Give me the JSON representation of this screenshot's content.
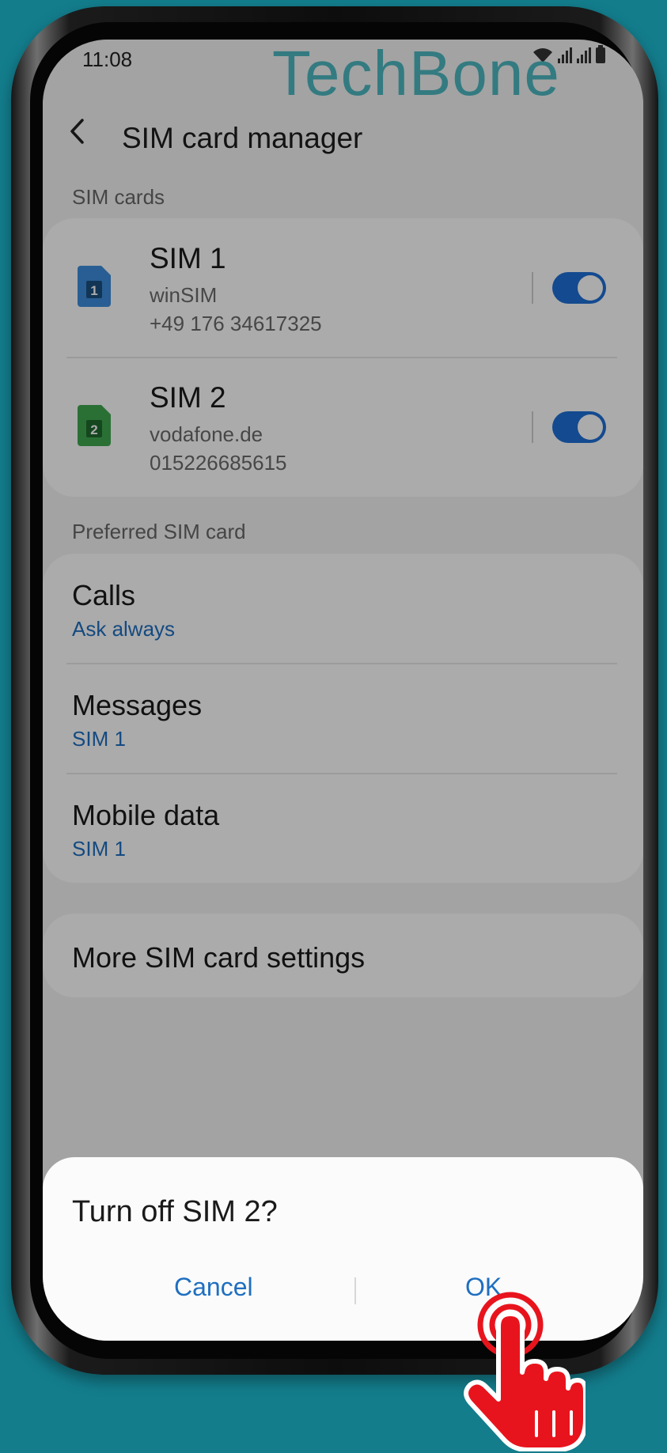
{
  "status": {
    "time": "11:08"
  },
  "watermark": "TechBone",
  "header": {
    "title": "SIM card manager"
  },
  "sim_section": {
    "header": "SIM cards",
    "sims": [
      {
        "badge": "1",
        "name": "SIM 1",
        "operator": "winSIM",
        "number": "+49 176 34617325",
        "enabled": true,
        "color": "#3d8ddb"
      },
      {
        "badge": "2",
        "name": "SIM 2",
        "operator": "vodafone.de",
        "number": "015226685615",
        "enabled": true,
        "color": "#3fa850"
      }
    ]
  },
  "preferred": {
    "header": "Preferred SIM card",
    "items": [
      {
        "title": "Calls",
        "value": "Ask always"
      },
      {
        "title": "Messages",
        "value": "SIM 1"
      },
      {
        "title": "Mobile data",
        "value": "SIM 1"
      }
    ]
  },
  "more": {
    "label": "More SIM card settings"
  },
  "dialog": {
    "title": "Turn off SIM 2?",
    "cancel": "Cancel",
    "ok": "OK"
  },
  "colors": {
    "accent": "#1f6fd6",
    "background": "#137d8c",
    "hand": "#e8141d"
  }
}
